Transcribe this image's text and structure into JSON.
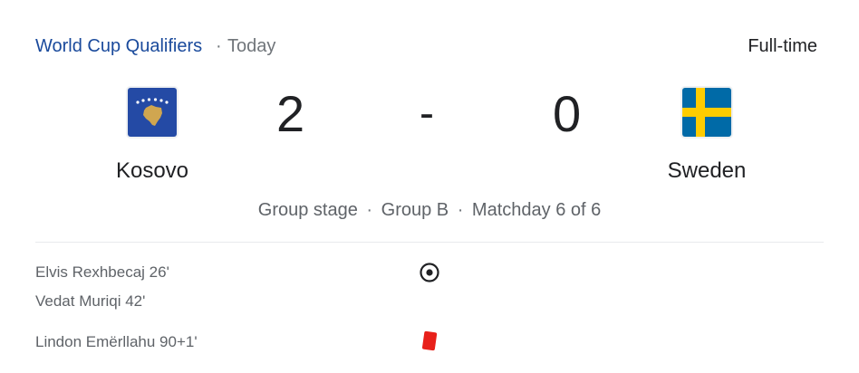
{
  "header": {
    "competition": "World Cup Qualifiers",
    "separator": "·",
    "date": "Today",
    "status": "Full-time"
  },
  "match": {
    "home": {
      "name": "Kosovo",
      "score": "2",
      "flag_icon": "kosovo-flag-icon"
    },
    "away": {
      "name": "Sweden",
      "score": "0",
      "flag_icon": "sweden-flag-icon"
    },
    "dash": "-"
  },
  "stage": {
    "phase": "Group stage",
    "group": "Group B",
    "matchday": "Matchday 6 of 6",
    "separator": "·"
  },
  "events": [
    {
      "text": "Elvis Rexhbecaj 26'",
      "icon": "goal-icon"
    },
    {
      "text": "Vedat Muriqi 42'",
      "icon": "goal-icon"
    },
    {
      "text": "Lindon Emërllahu 90+1'",
      "icon": "red-card-icon"
    }
  ],
  "colors": {
    "link": "#1a4a9c",
    "kosovo_blue": "#244aa5",
    "kosovo_gold": "#d0a650",
    "sweden_blue": "#006aa7",
    "sweden_yellow": "#fecc00",
    "red_card": "#e8201a"
  }
}
